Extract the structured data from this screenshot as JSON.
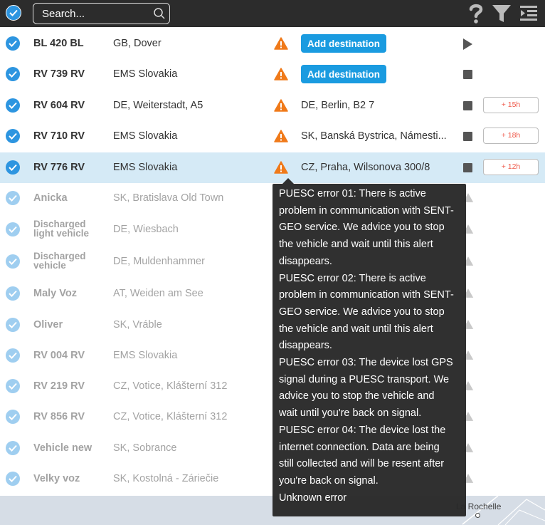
{
  "toolbar": {
    "search_placeholder": "Search...",
    "select_all_checked": true
  },
  "colors": {
    "accent": "#2d95e0",
    "button_blue": "#1a9be0",
    "warning_orange": "#f07a1a",
    "delay_red": "#ef5b4c",
    "topbar": "#2c2c2c"
  },
  "vehicles": [
    {
      "name": "BL 420 BL",
      "location": "GB, Dover",
      "destination_button": "Add destination",
      "control": "play"
    },
    {
      "name": "RV 739 RV",
      "location": "EMS Slovakia",
      "destination_button": "Add destination",
      "control": "stop"
    },
    {
      "name": "RV 604 RV",
      "location": "DE, Weiterstadt, A5",
      "destination": "DE, Berlin, B2 7",
      "control": "stop",
      "delay": "+ 15h"
    },
    {
      "name": "RV 710 RV",
      "location": "EMS Slovakia",
      "destination": "SK, Banská Bystrica, Námesti...",
      "control": "stop",
      "delay": "+ 18h"
    },
    {
      "name": "RV 776 RV",
      "location": "EMS Slovakia",
      "destination": "CZ, Praha, Wilsonova 300/8",
      "control": "stop",
      "delay": "+ 12h",
      "selected": true
    },
    {
      "name": "Anicka",
      "location": "SK, Bratislava Old Town"
    },
    {
      "name_line1": "Discharged",
      "name_line2": "light vehicle",
      "location": "DE, Wiesbach"
    },
    {
      "name_line1": "Discharged",
      "name_line2": "vehicle",
      "location": "DE, Muldenhammer"
    },
    {
      "name": "Maly Voz",
      "location": "AT, Weiden am See"
    },
    {
      "name": "Oliver",
      "location": "SK, Vráble"
    },
    {
      "name": "RV 004 RV",
      "location": "EMS Slovakia"
    },
    {
      "name": "RV 219 RV",
      "location": "CZ, Votice, Klášterní 312"
    },
    {
      "name": "RV 856 RV",
      "location": "CZ, Votice, Klášterní 312"
    },
    {
      "name": "Vehicle new",
      "location": "SK, Sobrance"
    },
    {
      "name": "Velky voz",
      "location": "SK, Kostolná - Záriečie"
    }
  ],
  "tooltip": {
    "lines": [
      "PUESC error 01: There is active",
      "problem in communication with SENT-",
      "GEO service. We advice you to stop",
      "the vehicle and wait until this alert",
      "disappears.",
      "PUESC error 02: There is active",
      "problem in communication with SENT-",
      "GEO service. We advice you to stop",
      "the vehicle and wait until this alert",
      "disappears.",
      "PUESC error 03: The device lost GPS",
      "signal during a PUESC transport. We",
      "advice you to stop the vehicle and",
      "wait until you're back on signal.",
      "PUESC error 04: The device lost the",
      "internet connection. Data are being",
      "still collected and will be resent after",
      "you're back on signal.",
      "Unknown error"
    ]
  },
  "map": {
    "place_label": "La Rochelle"
  }
}
